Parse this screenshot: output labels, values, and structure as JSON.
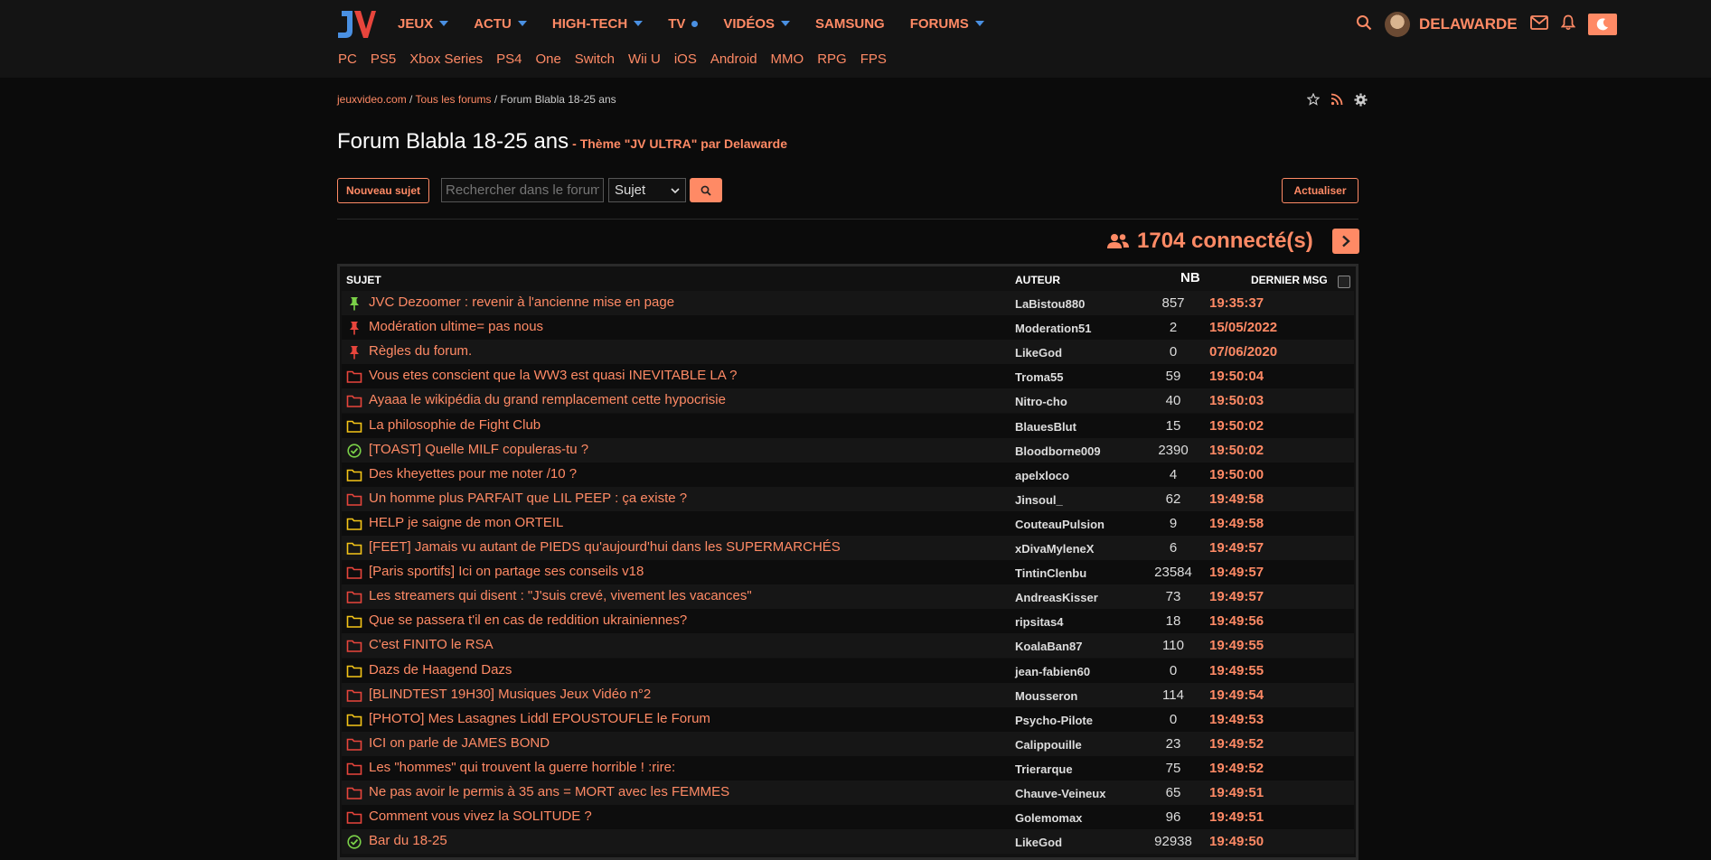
{
  "logo": {
    "text": "JV"
  },
  "nav": {
    "main": [
      {
        "label": "JEUX",
        "marker": "caret"
      },
      {
        "label": "ACTU",
        "marker": "caret"
      },
      {
        "label": "HIGH-TECH",
        "marker": "caret"
      },
      {
        "label": "TV",
        "marker": "dot"
      },
      {
        "label": "VIDÉOS",
        "marker": "caret"
      },
      {
        "label": "SAMSUNG",
        "marker": "none"
      },
      {
        "label": "FORUMS",
        "marker": "caret"
      }
    ],
    "sub": [
      "PC",
      "PS5",
      "Xbox Series",
      "PS4",
      "One",
      "Switch",
      "Wii U",
      "iOS",
      "Android",
      "MMO",
      "RPG",
      "FPS"
    ]
  },
  "user": {
    "name": "DELAWARDE"
  },
  "breadcrumb": {
    "home": "jeuxvideo.com",
    "sep1": " / ",
    "all": "Tous les forums",
    "sep2": " / ",
    "current": "Forum Blabla 18-25 ans"
  },
  "page": {
    "title": "Forum Blabla 18-25 ans",
    "theme": "- Thème \"JV ULTRA\" par Delawarde"
  },
  "toolbar": {
    "new_topic": "Nouveau sujet",
    "search_placeholder": "Rechercher dans le forum",
    "search_scope": "Sujet",
    "refresh": "Actualiser"
  },
  "connected": {
    "text": "1704 connecté(s)"
  },
  "table": {
    "headers": {
      "subject": "SUJET",
      "author": "AUTEUR",
      "nb": "NB",
      "last": "DERNIER MSG"
    },
    "rows": [
      {
        "icon": "pin-green",
        "subject": "JVC Dezoomer : revenir à l'ancienne mise en page",
        "author": "LaBistou880",
        "nb": "857",
        "last": "19:35:37"
      },
      {
        "icon": "pin-red",
        "subject": "Modération ultime= pas nous",
        "author": "Moderation51",
        "nb": "2",
        "last": "15/05/2022"
      },
      {
        "icon": "pin-red",
        "subject": "Règles du forum.",
        "author": "LikeGod",
        "nb": "0",
        "last": "07/06/2020"
      },
      {
        "icon": "folder-red",
        "subject": "Vous etes conscient que la WW3 est quasi INEVITABLE LA ?",
        "author": "Troma55",
        "nb": "59",
        "last": "19:50:04"
      },
      {
        "icon": "folder-red",
        "subject": "Ayaaa le wikipédia du grand remplacement cette hypocrisie",
        "author": "Nitro-cho",
        "nb": "40",
        "last": "19:50:03"
      },
      {
        "icon": "folder-yellow",
        "subject": "La philosophie de Fight Club",
        "author": "BlauesBlut",
        "nb": "15",
        "last": "19:50:02"
      },
      {
        "icon": "check-green",
        "subject": "[TOAST] Quelle MILF copuleras-tu ?",
        "author": "Bloodborne009",
        "nb": "2390",
        "last": "19:50:02"
      },
      {
        "icon": "folder-yellow",
        "subject": "Des kheyettes pour me noter /10 ?",
        "author": "apelxloco",
        "nb": "4",
        "last": "19:50:00"
      },
      {
        "icon": "folder-red",
        "subject": "Un homme plus PARFAIT que LIL PEEP : ça existe ?",
        "author": "Jinsoul_",
        "nb": "62",
        "last": "19:49:58"
      },
      {
        "icon": "folder-yellow",
        "subject": "HELP je saigne de mon ORTEIL",
        "author": "CouteauPulsion",
        "nb": "9",
        "last": "19:49:58"
      },
      {
        "icon": "folder-yellow",
        "subject": "[FEET] Jamais vu autant de PIEDS qu'aujourd'hui dans les SUPERMARCHÉS",
        "author": "xDivaMyleneX",
        "nb": "6",
        "last": "19:49:57"
      },
      {
        "icon": "folder-red",
        "subject": "[Paris sportifs] Ici on partage ses conseils v18",
        "author": "TintinClenbu",
        "nb": "23584",
        "last": "19:49:57"
      },
      {
        "icon": "folder-red",
        "subject": "Les streamers qui disent : \"J'suis crevé, vivement les vacances\"",
        "author": "AndreasKisser",
        "nb": "73",
        "last": "19:49:57"
      },
      {
        "icon": "folder-yellow",
        "subject": "Que se passera t'il en cas de reddition ukrainiennes?",
        "author": "ripsitas4",
        "nb": "18",
        "last": "19:49:56"
      },
      {
        "icon": "folder-red",
        "subject": "C'est FINITO le RSA",
        "author": "KoalaBan87",
        "nb": "110",
        "last": "19:49:55"
      },
      {
        "icon": "folder-yellow",
        "subject": "Dazs de Haagend Dazs",
        "author": "jean-fabien60",
        "nb": "0",
        "last": "19:49:55"
      },
      {
        "icon": "folder-red",
        "subject": "[BLINDTEST 19H30] Musiques Jeux Vidéo n°2",
        "author": "Mousseron",
        "nb": "114",
        "last": "19:49:54"
      },
      {
        "icon": "folder-yellow",
        "subject": "[PHOTO] Mes Lasagnes Liddl EPOUSTOUFLE le Forum",
        "author": "Psycho-Pilote",
        "nb": "0",
        "last": "19:49:53"
      },
      {
        "icon": "folder-red",
        "subject": "ICI on parle de JAMES BOND",
        "author": "Calippouille",
        "nb": "23",
        "last": "19:49:52"
      },
      {
        "icon": "folder-red",
        "subject": "Les \"hommes\" qui trouvent la guerre horrible ! :rire:",
        "author": "Trierarque",
        "nb": "75",
        "last": "19:49:52"
      },
      {
        "icon": "folder-red",
        "subject": "Ne pas avoir le permis à 35 ans = MORT avec les FEMMES",
        "author": "Chauve-Veineux",
        "nb": "65",
        "last": "19:49:51"
      },
      {
        "icon": "folder-red",
        "subject": "Comment vous vivez la SOLITUDE ?",
        "author": "Golemomax",
        "nb": "96",
        "last": "19:49:51"
      },
      {
        "icon": "check-green",
        "subject": "Bar du 18-25",
        "author": "LikeGod",
        "nb": "92938",
        "last": "19:49:50"
      }
    ]
  },
  "colors": {
    "accent": "#ff8a65",
    "blue": "#4a90e2",
    "folder_red": "#e8453c",
    "folder_yellow": "#f5c518",
    "green": "#7bd148",
    "bg": "#0b0b0b"
  }
}
